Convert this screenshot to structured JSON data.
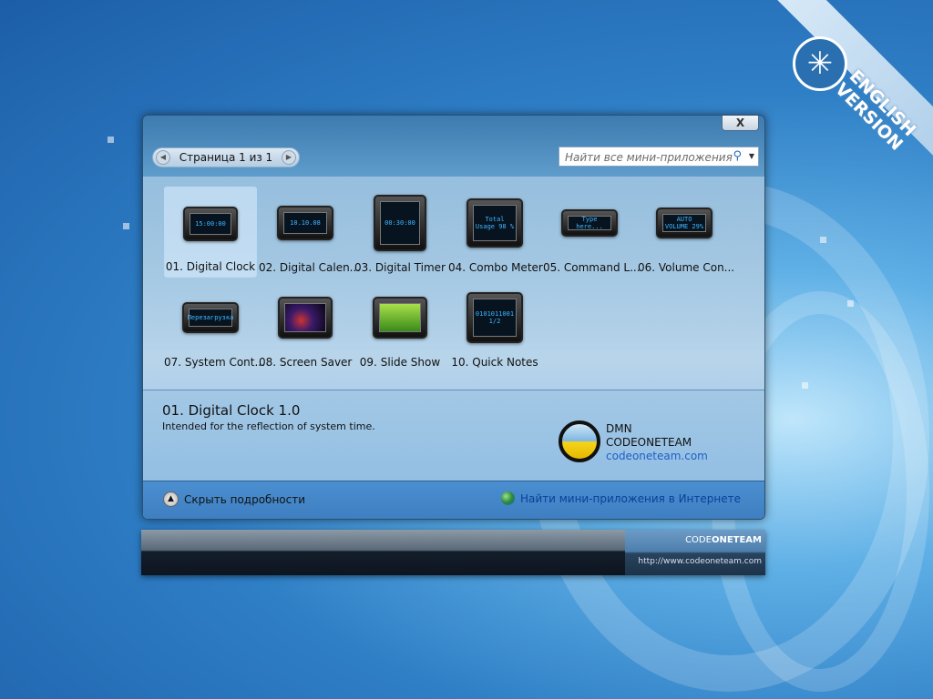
{
  "corner": {
    "ribbon_line1": "ENGLISH",
    "ribbon_line2": "VERSION"
  },
  "window": {
    "close_label": "X"
  },
  "toolbar": {
    "page_label": "Страница 1 из 1",
    "prev_icon": "chevron-left-icon",
    "next_icon": "chevron-right-icon",
    "search_placeholder": "Найти все мини-приложения"
  },
  "gadgets": [
    {
      "label": "01. Digital Clock",
      "screen": "15:00:00",
      "selected": true
    },
    {
      "label": "02. Digital Calen...",
      "screen": "10.10.08"
    },
    {
      "label": "03. Digital Timer",
      "screen": "00:30:00"
    },
    {
      "label": "04. Combo Meter",
      "screen": "Total Usage 98 %"
    },
    {
      "label": "05. Command L...",
      "screen": "Type here..."
    },
    {
      "label": "06. Volume Con...",
      "screen": "AUTO VOLUME 29%"
    },
    {
      "label": "07. System Cont...",
      "screen": "Перезагрузка"
    },
    {
      "label": "08. Screen Saver",
      "screen": ""
    },
    {
      "label": "09. Slide Show",
      "screen": ""
    },
    {
      "label": "10. Quick Notes",
      "screen": "0101011001 1/2"
    }
  ],
  "details": {
    "title": "01. Digital Clock 1.0",
    "description": "Intended for the reflection of system time.",
    "publisher": "DMN",
    "company": "CODEONETEAM",
    "link": "codeoneteam.com"
  },
  "bottom": {
    "hide_details": "Скрыть подробности",
    "get_online": "Найти мини-приложения в Интернете"
  },
  "banner": {
    "brand_light": "CODE",
    "brand_bold": "ONETEAM",
    "url": "http://www.codeoneteam.com"
  }
}
